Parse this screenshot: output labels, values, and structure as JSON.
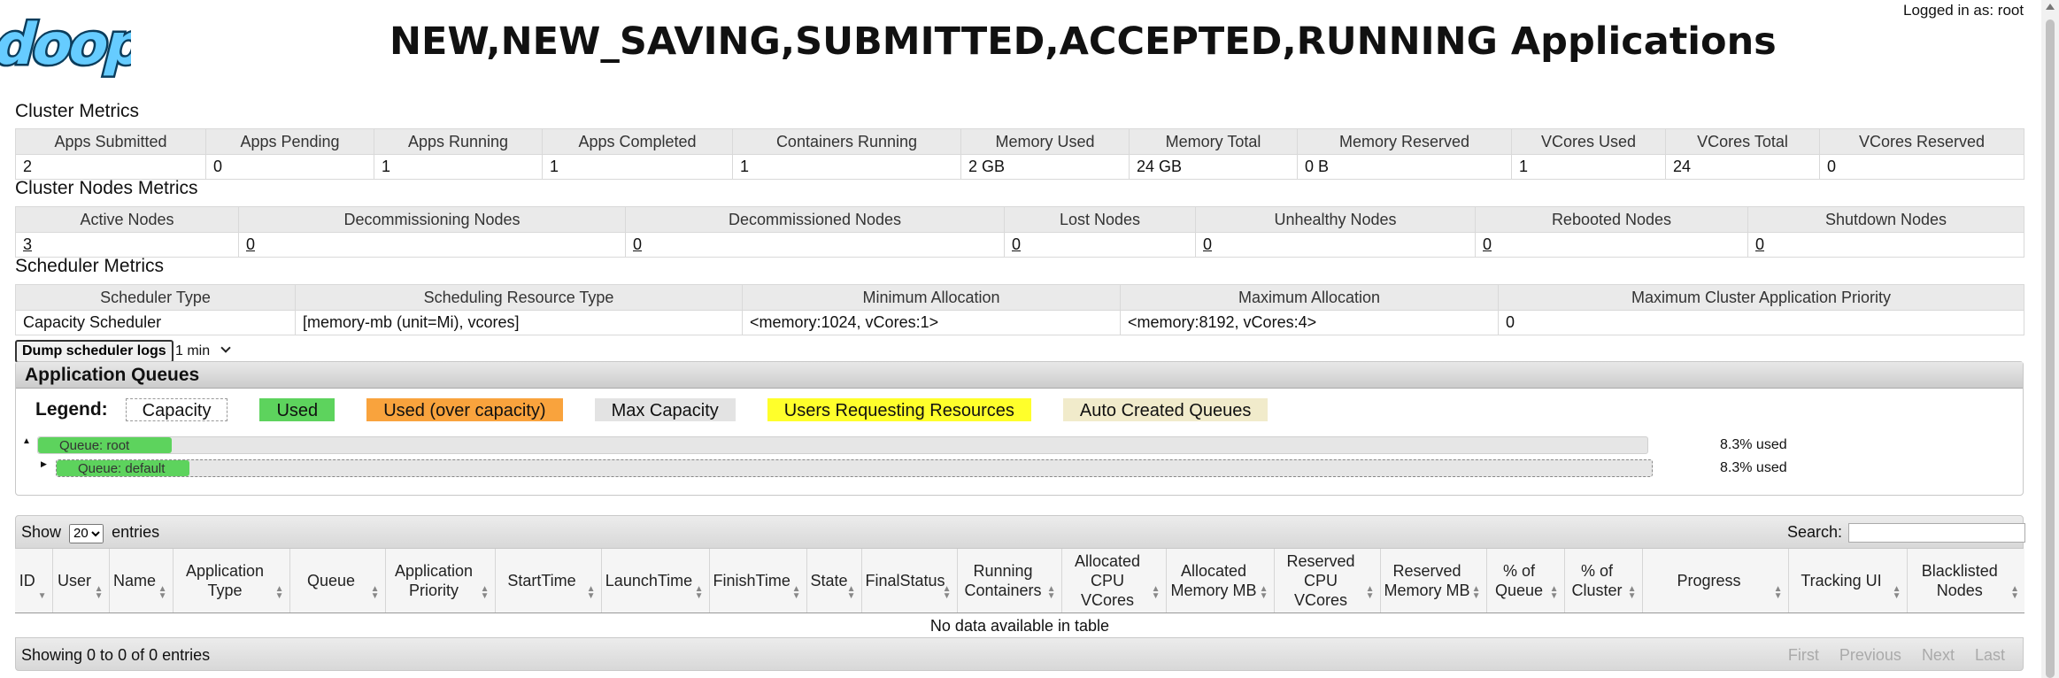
{
  "header": {
    "title": "NEW,NEW_SAVING,SUBMITTED,ACCEPTED,RUNNING Applications",
    "logged_in": "Logged in as: root",
    "logo_text": "doop"
  },
  "cluster_metrics": {
    "title": "Cluster Metrics",
    "headers": [
      "Apps Submitted",
      "Apps Pending",
      "Apps Running",
      "Apps Completed",
      "Containers Running",
      "Memory Used",
      "Memory Total",
      "Memory Reserved",
      "VCores Used",
      "VCores Total",
      "VCores Reserved"
    ],
    "values": [
      "2",
      "0",
      "1",
      "1",
      "1",
      "2 GB",
      "24 GB",
      "0 B",
      "1",
      "24",
      "0"
    ]
  },
  "cluster_nodes_metrics": {
    "title": "Cluster Nodes Metrics",
    "headers": [
      "Active Nodes",
      "Decommissioning Nodes",
      "Decommissioned Nodes",
      "Lost Nodes",
      "Unhealthy Nodes",
      "Rebooted Nodes",
      "Shutdown Nodes"
    ],
    "values": [
      "3",
      "0",
      "0",
      "0",
      "0",
      "0",
      "0"
    ]
  },
  "scheduler_metrics": {
    "title": "Scheduler Metrics",
    "headers": [
      "Scheduler Type",
      "Scheduling Resource Type",
      "Minimum Allocation",
      "Maximum Allocation",
      "Maximum Cluster Application Priority"
    ],
    "values": [
      "Capacity Scheduler",
      "[memory-mb (unit=Mi), vcores]",
      "<memory:1024, vCores:1>",
      "<memory:8192, vCores:4>",
      "0"
    ]
  },
  "scheduler_controls": {
    "dump_button": "Dump scheduler logs",
    "interval": "1 min"
  },
  "queues": {
    "title": "Application Queues",
    "legend_label": "Legend:",
    "legend": [
      "Capacity",
      "Used",
      "Used (over capacity)",
      "Max Capacity",
      "Users Requesting Resources",
      "Auto Created Queues"
    ],
    "rows": [
      {
        "label": "Queue: root",
        "used_text": "8.3% used",
        "used_fraction": 0.083,
        "toggle": "▲"
      },
      {
        "label": "Queue: default",
        "used_text": "8.3% used",
        "used_fraction": 0.083,
        "toggle": "▶"
      }
    ]
  },
  "applications": {
    "show_label": "Show",
    "page_size": "20",
    "entries_label": "entries",
    "search_label": "Search:",
    "search_value": "",
    "columns": [
      "ID",
      "User",
      "Name",
      "Application Type",
      "Queue",
      "Application Priority",
      "StartTime",
      "LaunchTime",
      "FinishTime",
      "State",
      "FinalStatus",
      "Running Containers",
      "Allocated CPU VCores",
      "Allocated Memory MB",
      "Reserved CPU VCores",
      "Reserved Memory MB",
      "% of Queue",
      "% of Cluster",
      "Progress",
      "Tracking UI",
      "Blacklisted Nodes"
    ],
    "empty_text": "No data available in table",
    "info_text": "Showing 0 to 0 of 0 entries",
    "pager": [
      "First",
      "Previous",
      "Next",
      "Last"
    ]
  },
  "colors": {
    "used": "#5dd35d",
    "over_capacity": "#f9a33d",
    "max_capacity": "#e3e3e3",
    "users_requesting": "#ffff2b",
    "auto_created": "#f1ebcb",
    "logo": "#66ccff"
  }
}
